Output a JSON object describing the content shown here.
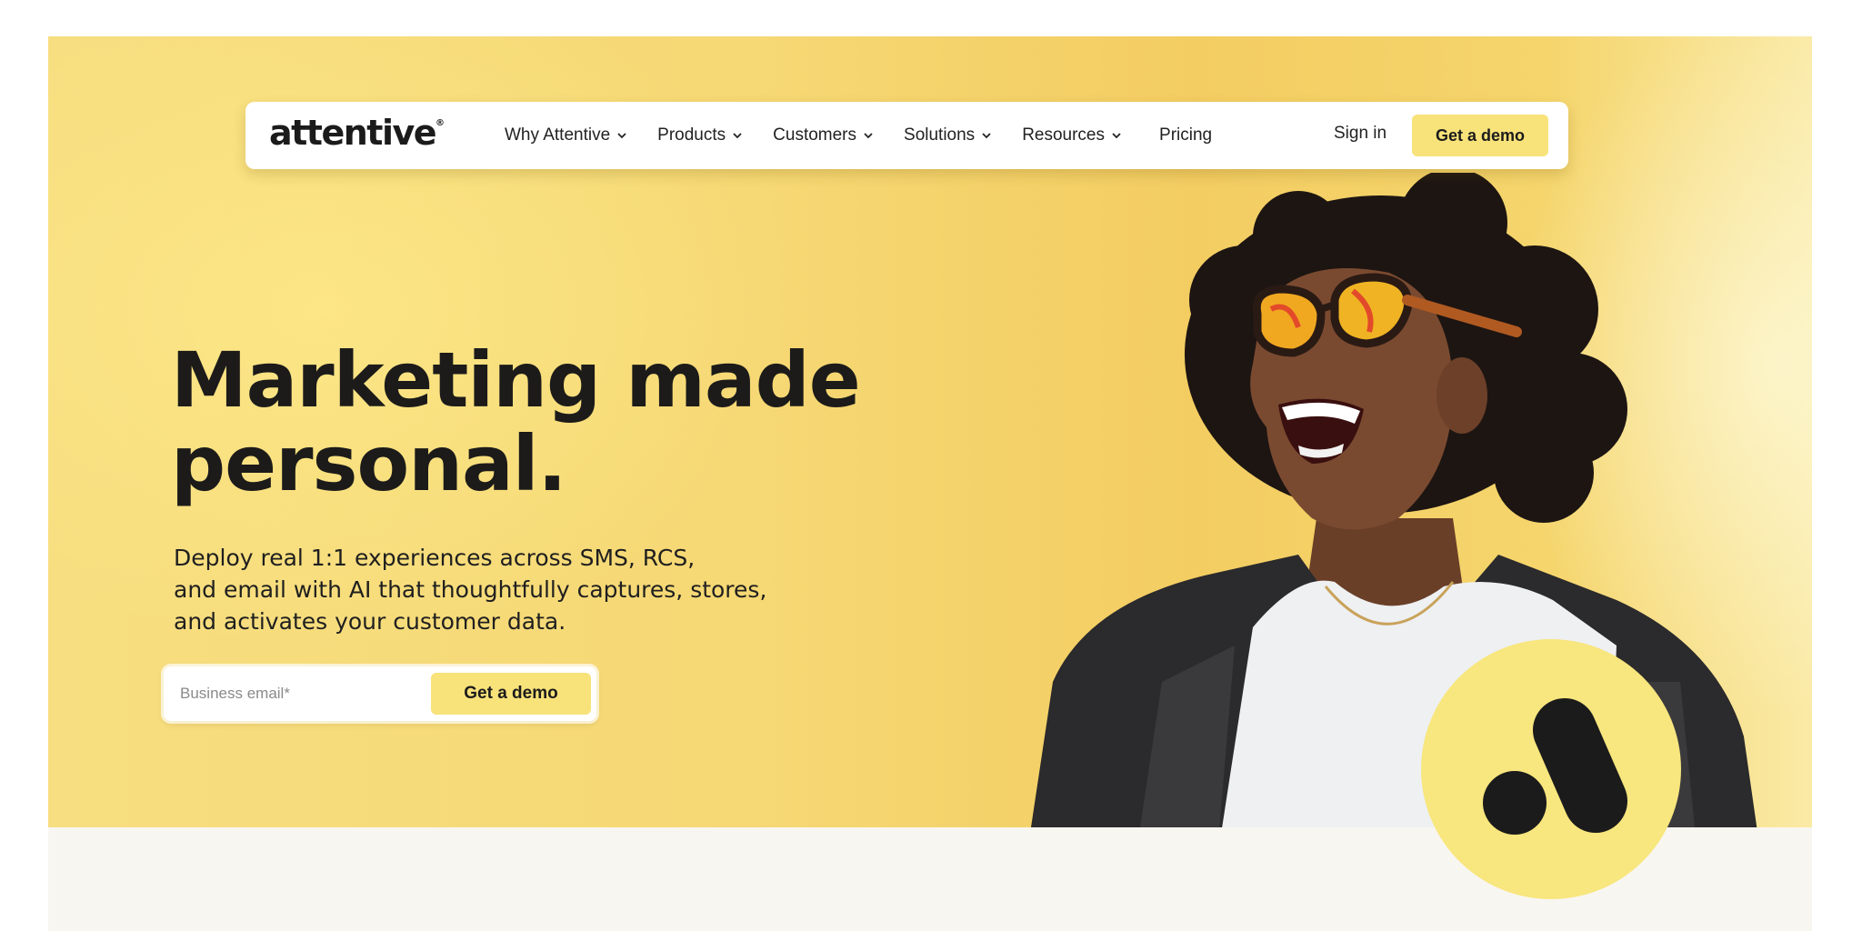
{
  "nav": {
    "logo": "attentive",
    "items": [
      {
        "label": "Why Attentive",
        "has_dropdown": true,
        "icon": "chevron-down-icon"
      },
      {
        "label": "Products",
        "has_dropdown": true,
        "icon": "chevron-down-icon"
      },
      {
        "label": "Customers",
        "has_dropdown": true,
        "icon": "chevron-down-icon"
      },
      {
        "label": "Solutions",
        "has_dropdown": true,
        "icon": "chevron-down-icon"
      },
      {
        "label": "Resources",
        "has_dropdown": true,
        "icon": "chevron-down-icon"
      },
      {
        "label": "Pricing",
        "has_dropdown": false
      }
    ],
    "sign_in": "Sign in",
    "cta": "Get a demo"
  },
  "hero": {
    "headline_line1": "Marketing made",
    "headline_line2": "personal.",
    "subtext_line1": "Deploy real 1:1 experiences across SMS, RCS,",
    "subtext_line2": "and email with AI that thoughtfully captures, stores,",
    "subtext_line3": "and activates your customer data.",
    "email_placeholder": "Business email*",
    "email_value": "",
    "cta": "Get a demo"
  },
  "badge": {
    "icon": "attentive-a-logo-icon"
  },
  "colors": {
    "hero_background": "#f6d874",
    "cta_yellow": "#f8e27a",
    "text_dark": "#1c1b1a",
    "badge": "#f8e67e",
    "section_below": "#f8f6f0"
  }
}
